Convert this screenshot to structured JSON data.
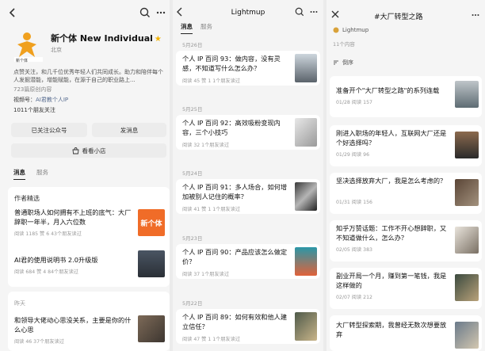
{
  "account": {
    "name": "新个体 New Individual",
    "location": "北京",
    "description": "点赞关注，和几千位优秀年轻人们共同成长。助力和陪伴每个人发掘潜能，增能赋能，在源于自己的职业路上...",
    "article_count": "723篇原创内容",
    "video_prefix": "视频号：",
    "video_name": "AI君教个人IP",
    "friends": "1011个朋友关注",
    "followed_label": "已关注公众号",
    "message_label": "发消息",
    "shop_label": "看看小店",
    "tab_messages": "消息",
    "tab_service": "服务",
    "section_label": "作者精选",
    "picks": [
      {
        "title": "普通职场人如何拥有不上班的底气：大厂辞职一年半，月入六位数",
        "meta": "阅读 1185  赞 6  43个朋友读过",
        "thumb_text": "新个体"
      },
      {
        "title": "AI君的使用说明书 2.0升级版",
        "meta": "阅读 684  赞 4  84个朋友读过"
      }
    ],
    "yesterday": "昨天",
    "latest": {
      "title": "和领导大佬动心思没关系，主要是你的什么心思",
      "meta": "阅读 46  37个朋友读过"
    }
  },
  "list": {
    "title": "Lightmup",
    "tab_messages": "消息",
    "tab_service": "服务",
    "items": [
      {
        "date": "5月26日",
        "title": "个人 IP 百问 93：做内容，没有灵感，不知道写什么怎么办？",
        "meta": "阅读 45  赞 1  1个朋友读过"
      },
      {
        "date": "5月25日",
        "title": "个人 IP 百问 92：高效吸粉变现内容，三个小技巧",
        "meta": "阅读 32  1个朋友读过"
      },
      {
        "date": "5月24日",
        "title": "个人 IP 百问 91：多人场合，如何增加被别人记住的概率？",
        "meta": "阅读 41  赞 1  1个朋友读过"
      },
      {
        "date": "5月23日",
        "title": "个人 IP 百问 90：产品应该怎么做定价？",
        "meta": "阅读 37  1个朋友读过"
      },
      {
        "date": "5月22日",
        "title": "个人 IP 百问 89：如何有效和他人建立信任？",
        "meta": "阅读 47  赞 1  1个朋友读过"
      }
    ]
  },
  "collection": {
    "title": "#大厂转型之路",
    "account": "Lightmup",
    "subcount": "11个内容",
    "sort_label": "倒序",
    "items": [
      {
        "title": "准备开个\"大厂转型之路\"的系列连载",
        "date": "01/28 阅读 157"
      },
      {
        "title": "刚进入职场的年轻人，互联网大厂还是个好选择吗？",
        "date": "01/29 阅读 96"
      },
      {
        "title": "坚决选择放弃大厂，我是怎么考虑的？",
        "date": "01/31 阅读 156"
      },
      {
        "title": "知乎万赞话题：工作不开心想辞职，又不知道做什么，怎么办？",
        "date": "02/05 阅读 383"
      },
      {
        "title": "副业开局一个月，赚到第一笔钱，我是这样做的",
        "date": "02/07 阅读 212"
      },
      {
        "title": "大厂转型探索期，我曾经无数次想要放弃",
        "date": ""
      }
    ]
  }
}
